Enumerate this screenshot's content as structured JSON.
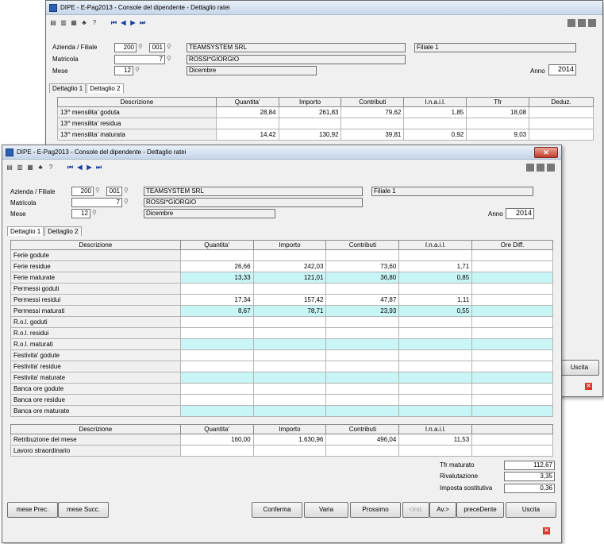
{
  "back": {
    "title": "DIPE  - E-Pag2013  - Console del dipendente - Dettaglio ratei",
    "azienda_label": "Azienda / Filiale",
    "azienda": "200",
    "filiale": "001",
    "company": "TEAMSYSTEM SRL",
    "filiale_name": "Filiale 1",
    "matricola_label": "Matricola",
    "matricola": "7",
    "employee": "ROSSI*GIORGIO",
    "mese_label": "Mese",
    "mese": "12",
    "mese_name": "Dicembre",
    "anno_label": "Anno",
    "anno": "2014",
    "tab1": "Dettaglio 1",
    "tab2": "Dettaglio 2",
    "headers": [
      "Descrizione",
      "Quantita'",
      "Importo",
      "Contributi",
      "I.n.a.i.l.",
      "Tfr",
      "Deduz."
    ],
    "rows": [
      {
        "d": "13^ mensilita' goduta",
        "v": [
          "28,84",
          "261,83",
          "79,62",
          "1,85",
          "18,08",
          ""
        ]
      },
      {
        "d": "13^ mensilita' residua",
        "v": [
          "",
          "",
          "",
          "",
          "",
          ""
        ]
      },
      {
        "d": "13^ mensilita' maturata",
        "v": [
          "14,42",
          "130,92",
          "39,81",
          "0,92",
          "9,03",
          ""
        ]
      }
    ],
    "uscita": "Uscita"
  },
  "front": {
    "title": "DIPE  - E-Pag2013  - Console del dipendente - Dettaglio ratei",
    "azienda_label": "Azienda / Filiale",
    "azienda": "200",
    "filiale": "001",
    "company": "TEAMSYSTEM SRL",
    "filiale_name": "Filiale 1",
    "matricola_label": "Matricola",
    "matricola": "7",
    "employee": "ROSSI*GIORGIO",
    "mese_label": "Mese",
    "mese": "12",
    "mese_name": "Dicembre",
    "anno_label": "Anno",
    "anno": "2014",
    "tab1": "Dettaglio 1",
    "tab2": "Dettaglio 2",
    "headers": [
      "Descrizione",
      "Quantita'",
      "Importo",
      "Contributi",
      "I.n.a.i.l.",
      "Ore Diff."
    ],
    "rows": [
      {
        "d": "Ferie godute",
        "v": [
          "",
          "",
          "",
          "",
          ""
        ],
        "cy": false
      },
      {
        "d": "Ferie residue",
        "v": [
          "26,66",
          "242,03",
          "73,60",
          "1,71",
          ""
        ],
        "cy": false
      },
      {
        "d": "Ferie maturate",
        "v": [
          "13,33",
          "121,01",
          "36,80",
          "0,85",
          ""
        ],
        "cy": true
      },
      {
        "d": "Permessi goduti",
        "v": [
          "",
          "",
          "",
          "",
          ""
        ],
        "cy": false
      },
      {
        "d": "Permessi residui",
        "v": [
          "17,34",
          "157,42",
          "47,87",
          "1,11",
          ""
        ],
        "cy": false
      },
      {
        "d": "Permessi maturati",
        "v": [
          "8,67",
          "78,71",
          "23,93",
          "0,55",
          ""
        ],
        "cy": true
      },
      {
        "d": "R.o.l. goduti",
        "v": [
          "",
          "",
          "",
          "",
          ""
        ],
        "cy": false
      },
      {
        "d": "R.o.l. residui",
        "v": [
          "",
          "",
          "",
          "",
          ""
        ],
        "cy": false
      },
      {
        "d": "R.o.l. maturati",
        "v": [
          "",
          "",
          "",
          "",
          ""
        ],
        "cy": true
      },
      {
        "d": "Festivita' godute",
        "v": [
          "",
          "",
          "",
          "",
          ""
        ],
        "cy": false
      },
      {
        "d": "Festivita' residue",
        "v": [
          "",
          "",
          "",
          "",
          ""
        ],
        "cy": false
      },
      {
        "d": "Festivita' maturate",
        "v": [
          "",
          "",
          "",
          "",
          ""
        ],
        "cy": true
      },
      {
        "d": "Banca ore godute",
        "v": [
          "",
          "",
          "",
          "",
          ""
        ],
        "cy": false
      },
      {
        "d": "Banca ore residue",
        "v": [
          "",
          "",
          "",
          "",
          ""
        ],
        "cy": false
      },
      {
        "d": "Banca ore maturate",
        "v": [
          "",
          "",
          "",
          "",
          ""
        ],
        "cy": true
      }
    ],
    "headers2": [
      "Descrizione",
      "Quantita'",
      "Importo",
      "Contributi",
      "I.n.a.i.l.",
      ""
    ],
    "rows2": [
      {
        "d": "Retribuzione del mese",
        "v": [
          "160,00",
          "1.630,96",
          "496,04",
          "11,53",
          ""
        ]
      },
      {
        "d": "Lavoro straordinario",
        "v": [
          "",
          "",
          "",
          "",
          ""
        ]
      }
    ],
    "tfr_label": "Tfr maturato",
    "tfr": "112,67",
    "riv_label": "Rivalutazione",
    "riv": "3,35",
    "imp_label": "Imposta sostitutiva",
    "imp": "0,36",
    "buttons": {
      "prec": "mese Prec.",
      "succ": "mese Succ.",
      "conferma": "Conferma",
      "varia": "Varia",
      "prossimo": "Prossimo",
      "ind": "<Ind.",
      "av": "Av.>",
      "precedente": "preceDente",
      "uscita": "Uscita"
    }
  }
}
